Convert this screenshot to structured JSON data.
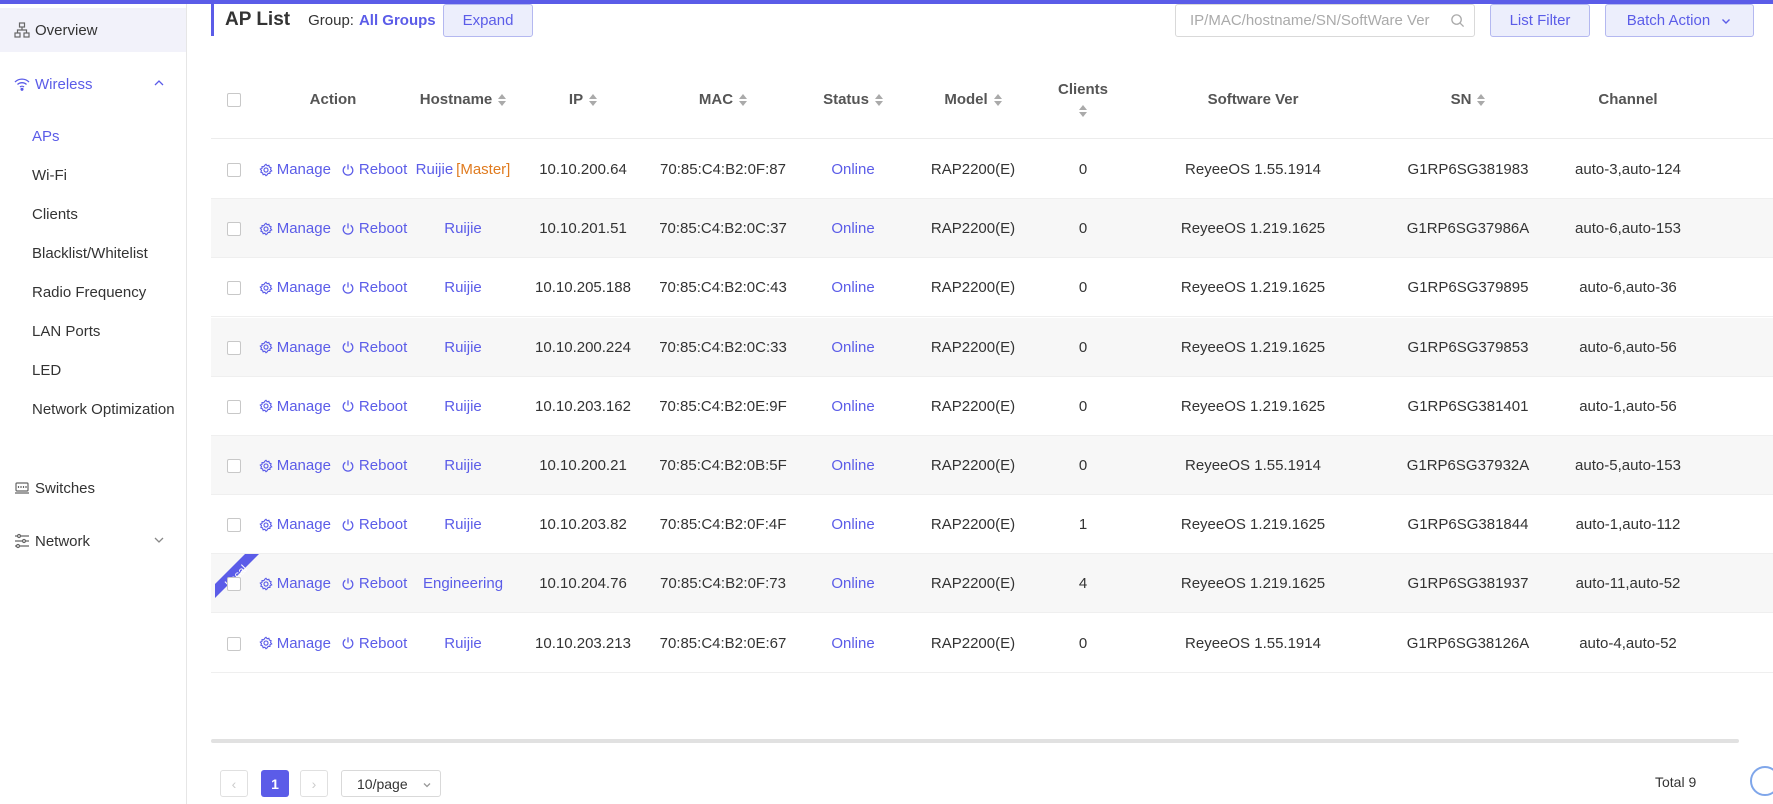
{
  "colors": {
    "accent": "#5b5ce8",
    "master": "#e07b1f",
    "badge": "#5b5ce8"
  },
  "sidebar": {
    "overview": "Overview",
    "wireless": "Wireless",
    "wireless_items": [
      "APs",
      "Wi-Fi",
      "Clients",
      "Blacklist/Whitelist",
      "Radio Frequency",
      "LAN Ports",
      "LED",
      "Network Optimization"
    ],
    "switches": "Switches",
    "network": "Network"
  },
  "header": {
    "title": "AP List",
    "group_label": "Group:",
    "group_value": "All Groups",
    "expand": "Expand",
    "search_placeholder": "IP/MAC/hostname/SN/SoftWare Ver",
    "list_filter": "List Filter",
    "batch_action": "Batch Action"
  },
  "table": {
    "columns": [
      "Action",
      "Hostname",
      "IP",
      "MAC",
      "Status",
      "Model",
      "Clients",
      "Software Ver",
      "SN",
      "Channel"
    ],
    "manage_label": "Manage",
    "reboot_label": "Reboot",
    "master_tag": "[Master]",
    "local_badge": "Local",
    "rows": [
      {
        "hostname": "Ruijie",
        "master": true,
        "ip": "10.10.200.64",
        "mac": "70:85:C4:B2:0F:87",
        "status": "Online",
        "model": "RAP2200(E)",
        "clients": "0",
        "software": "ReyeeOS 1.55.1914",
        "sn": "G1RP6SG381983",
        "channel": "auto-3,auto-124"
      },
      {
        "hostname": "Ruijie",
        "ip": "10.10.201.51",
        "mac": "70:85:C4:B2:0C:37",
        "status": "Online",
        "model": "RAP2200(E)",
        "clients": "0",
        "software": "ReyeeOS 1.219.1625",
        "sn": "G1RP6SG37986A",
        "channel": "auto-6,auto-153"
      },
      {
        "hostname": "Ruijie",
        "ip": "10.10.205.188",
        "mac": "70:85:C4:B2:0C:43",
        "status": "Online",
        "model": "RAP2200(E)",
        "clients": "0",
        "software": "ReyeeOS 1.219.1625",
        "sn": "G1RP6SG379895",
        "channel": "auto-6,auto-36"
      },
      {
        "hostname": "Ruijie",
        "ip": "10.10.200.224",
        "mac": "70:85:C4:B2:0C:33",
        "status": "Online",
        "model": "RAP2200(E)",
        "clients": "0",
        "software": "ReyeeOS 1.219.1625",
        "sn": "G1RP6SG379853",
        "channel": "auto-6,auto-56"
      },
      {
        "hostname": "Ruijie",
        "ip": "10.10.203.162",
        "mac": "70:85:C4:B2:0E:9F",
        "status": "Online",
        "model": "RAP2200(E)",
        "clients": "0",
        "software": "ReyeeOS 1.219.1625",
        "sn": "G1RP6SG381401",
        "channel": "auto-1,auto-56"
      },
      {
        "hostname": "Ruijie",
        "ip": "10.10.200.21",
        "mac": "70:85:C4:B2:0B:5F",
        "status": "Online",
        "model": "RAP2200(E)",
        "clients": "0",
        "software": "ReyeeOS 1.55.1914",
        "sn": "G1RP6SG37932A",
        "channel": "auto-5,auto-153"
      },
      {
        "hostname": "Ruijie",
        "ip": "10.10.203.82",
        "mac": "70:85:C4:B2:0F:4F",
        "status": "Online",
        "model": "RAP2200(E)",
        "clients": "1",
        "software": "ReyeeOS 1.219.1625",
        "sn": "G1RP6SG381844",
        "channel": "auto-1,auto-112"
      },
      {
        "hostname": "Engineering",
        "local": true,
        "ip": "10.10.204.76",
        "mac": "70:85:C4:B2:0F:73",
        "status": "Online",
        "model": "RAP2200(E)",
        "clients": "4",
        "software": "ReyeeOS 1.219.1625",
        "sn": "G1RP6SG381937",
        "channel": "auto-11,auto-52"
      },
      {
        "hostname": "Ruijie",
        "ip": "10.10.203.213",
        "mac": "70:85:C4:B2:0E:67",
        "status": "Online",
        "model": "RAP2200(E)",
        "clients": "0",
        "software": "ReyeeOS 1.55.1914",
        "sn": "G1RP6SG38126A",
        "channel": "auto-4,auto-52"
      }
    ]
  },
  "pagination": {
    "prev": "‹",
    "current": "1",
    "next": "›",
    "page_size": "10/page",
    "total": "Total 9"
  }
}
